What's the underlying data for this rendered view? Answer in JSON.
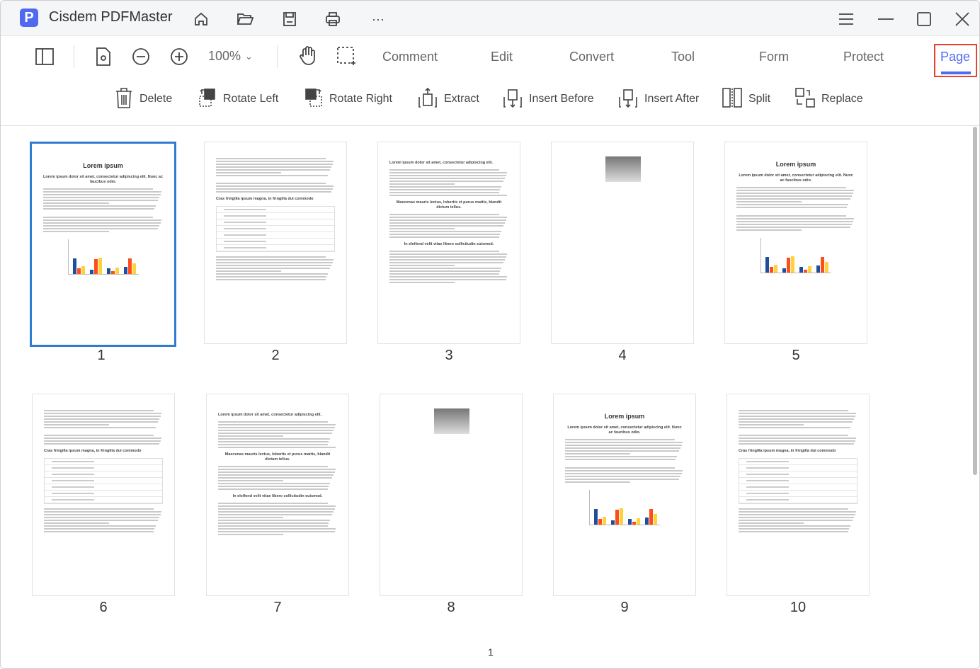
{
  "app": {
    "title": "Cisdem PDFMaster",
    "logo_letter": "P"
  },
  "toolbar": {
    "zoom": "100%"
  },
  "tabs": [
    {
      "label": "Comment"
    },
    {
      "label": "Edit"
    },
    {
      "label": "Convert"
    },
    {
      "label": "Tool"
    },
    {
      "label": "Form"
    },
    {
      "label": "Protect"
    },
    {
      "label": "Page",
      "active": true
    }
  ],
  "page_tools": [
    {
      "label": "Delete",
      "icon": "trash-icon"
    },
    {
      "label": "Rotate Left",
      "icon": "rotate-left-icon"
    },
    {
      "label": "Rotate Right",
      "icon": "rotate-right-icon"
    },
    {
      "label": "Extract",
      "icon": "extract-icon"
    },
    {
      "label": "Insert Before",
      "icon": "insert-before-icon"
    },
    {
      "label": "Insert After",
      "icon": "insert-after-icon"
    },
    {
      "label": "Split",
      "icon": "split-icon"
    },
    {
      "label": "Replace",
      "icon": "replace-icon"
    }
  ],
  "thumb_text": {
    "title": "Lorem ipsum",
    "subtitle": "Lorem ipsum dolor sit amet, consectetur adipiscing elit. Nunc ac faucibus odio.",
    "h_table": "Cras fringilla ipsum magna, in fringilla dui commodo",
    "h_text1": "Lorem ipsum dolor sit amet, consectetur adipiscing elit.",
    "h_text2": "Maecenas mauris lectus, lobortis et purus mattis, blandit dictum tellus.",
    "h_text3": "In eleifend velit vitae libero sollicitudin euismod."
  },
  "pages": [
    {
      "label": "1",
      "type": "chart",
      "selected": true
    },
    {
      "label": "2",
      "type": "table"
    },
    {
      "label": "3",
      "type": "text"
    },
    {
      "label": "4",
      "type": "image"
    },
    {
      "label": "5",
      "type": "chart"
    },
    {
      "label": "6",
      "type": "table"
    },
    {
      "label": "7",
      "type": "text"
    },
    {
      "label": "8",
      "type": "image"
    },
    {
      "label": "9",
      "type": "chart"
    },
    {
      "label": "10",
      "type": "table"
    }
  ],
  "footer": {
    "page_indicator": "1"
  },
  "colors": {
    "accent": "#4f6af0",
    "selection": "#2f7dd1",
    "highlight": "#e8432e"
  }
}
